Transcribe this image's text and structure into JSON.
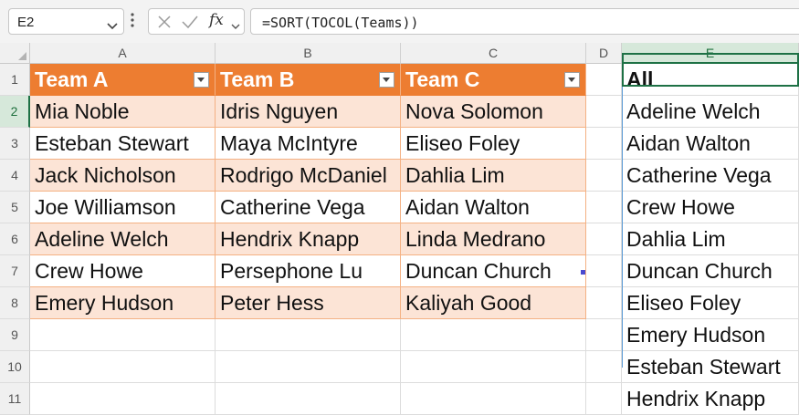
{
  "formula_bar": {
    "name_box": "E2",
    "formula": "=SORT(TOCOL(Teams))",
    "fx_label": "fx",
    "icons": [
      "chevron-down-icon",
      "more-vertical-icon",
      "cancel-x-icon",
      "check-icon",
      "function-icon"
    ]
  },
  "columns": [
    "A",
    "B",
    "C",
    "D",
    "E"
  ],
  "rows": [
    "1",
    "2",
    "3",
    "4",
    "5",
    "6",
    "7",
    "8",
    "9",
    "10",
    "11"
  ],
  "table": {
    "name": "Teams",
    "header_color": "#ed7d31",
    "band_color": "#fce4d6",
    "headers": [
      "Team A",
      "Team B",
      "Team C"
    ],
    "data": [
      [
        "Mia Noble",
        "Idris Nguyen",
        "Nova Solomon"
      ],
      [
        "Esteban Stewart",
        "Maya McIntyre",
        "Eliseo Foley"
      ],
      [
        "Jack Nicholson",
        "Rodrigo McDaniel",
        "Dahlia Lim"
      ],
      [
        "Joe Williamson",
        "Catherine Vega",
        "Aidan Walton"
      ],
      [
        "Adeline Welch",
        "Hendrix Knapp",
        "Linda Medrano"
      ],
      [
        "Crew Howe",
        "Persephone Lu",
        "Duncan Church"
      ],
      [
        "Emery Hudson",
        "Peter Hess",
        "Kaliyah Good"
      ]
    ]
  },
  "column_e": {
    "header": "All",
    "values": [
      "Adeline Welch",
      "Aidan Walton",
      "Catherine Vega",
      "Crew Howe",
      "Dahlia Lim",
      "Duncan Church",
      "Eliseo Foley",
      "Emery Hudson",
      "Esteban Stewart",
      "Hendrix Knapp"
    ]
  },
  "active_cell": "E2",
  "accent_color": "#1e7145"
}
